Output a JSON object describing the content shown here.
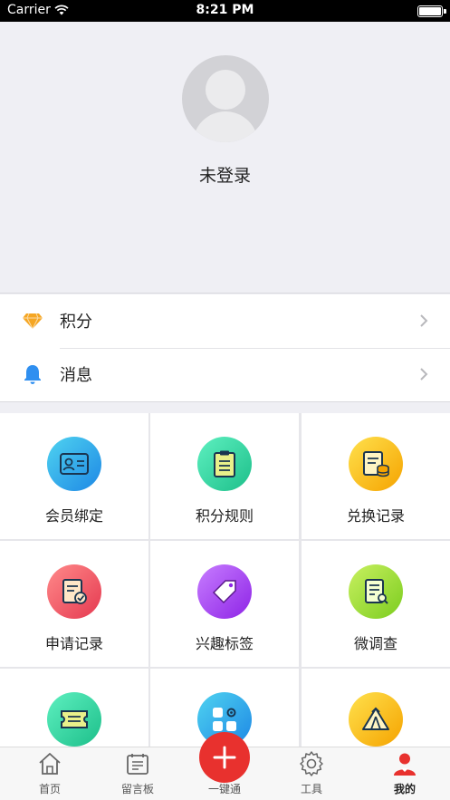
{
  "status_bar": {
    "carrier": "Carrier",
    "time": "8:21 PM"
  },
  "profile": {
    "login_text": "未登录"
  },
  "list": [
    {
      "label": "积分",
      "icon": "diamond-icon",
      "color": "#f5a623"
    },
    {
      "label": "消息",
      "icon": "bell-icon",
      "color": "#2f8ff0"
    }
  ],
  "grid": [
    {
      "label": "会员绑定",
      "icon": "member-card-icon",
      "gradient": [
        "#4fd3f0",
        "#1e88e5"
      ]
    },
    {
      "label": "积分规则",
      "icon": "clipboard-icon",
      "gradient": [
        "#5ef0c0",
        "#1dbf8a"
      ]
    },
    {
      "label": "兑换记录",
      "icon": "exchange-record-icon",
      "gradient": [
        "#ffe14d",
        "#f5a300"
      ]
    },
    {
      "label": "申请记录",
      "icon": "application-record-icon",
      "gradient": [
        "#ff8a8a",
        "#e53950"
      ]
    },
    {
      "label": "兴趣标签",
      "icon": "tag-icon",
      "gradient": [
        "#c77dff",
        "#8e24e6"
      ]
    },
    {
      "label": "微调查",
      "icon": "survey-icon",
      "gradient": [
        "#c8f060",
        "#7ccd1f"
      ]
    },
    {
      "label": "",
      "icon": "ticket-icon",
      "gradient": [
        "#5ef0c0",
        "#1dbf8a"
      ]
    },
    {
      "label": "",
      "icon": "apps-settings-icon",
      "gradient": [
        "#4fd3f0",
        "#1e88e5"
      ]
    },
    {
      "label": "",
      "icon": "tent-icon",
      "gradient": [
        "#ffe14d",
        "#f5a300"
      ]
    }
  ],
  "tabbar": {
    "tabs": [
      {
        "label": "首页",
        "icon": "home-icon"
      },
      {
        "label": "留言板",
        "icon": "message-board-icon"
      },
      {
        "label": "工具",
        "icon": "gear-icon"
      },
      {
        "label": "我的",
        "icon": "user-icon",
        "active": true
      }
    ],
    "center": {
      "label": "一键通",
      "icon": "plus-icon",
      "color": "#e8312e"
    }
  }
}
